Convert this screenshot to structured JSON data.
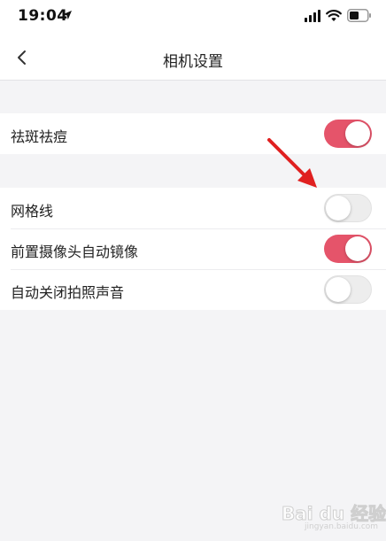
{
  "status_bar": {
    "time": "19:04",
    "icons": [
      "location-arrow-icon",
      "cellular-signal-icon",
      "wifi-icon",
      "battery-icon"
    ]
  },
  "nav": {
    "back_icon": "chevron-left-icon",
    "title": "相机设置"
  },
  "settings_groups": [
    {
      "items": [
        {
          "label": "祛斑祛痘",
          "enabled": true
        }
      ]
    },
    {
      "items": [
        {
          "label": "网格线",
          "enabled": false
        },
        {
          "label": "前置摄像头自动镜像",
          "enabled": true
        },
        {
          "label": "自动关闭拍照声音",
          "enabled": false
        }
      ]
    }
  ],
  "annotation": {
    "arrow_color": "#e02020"
  },
  "watermark": {
    "text": "Bai du 经验",
    "sub": "jingyan.baidu.com"
  },
  "colors": {
    "toggle_on": "#e5546a",
    "toggle_off": "#ededed",
    "background": "#f4f4f6"
  }
}
